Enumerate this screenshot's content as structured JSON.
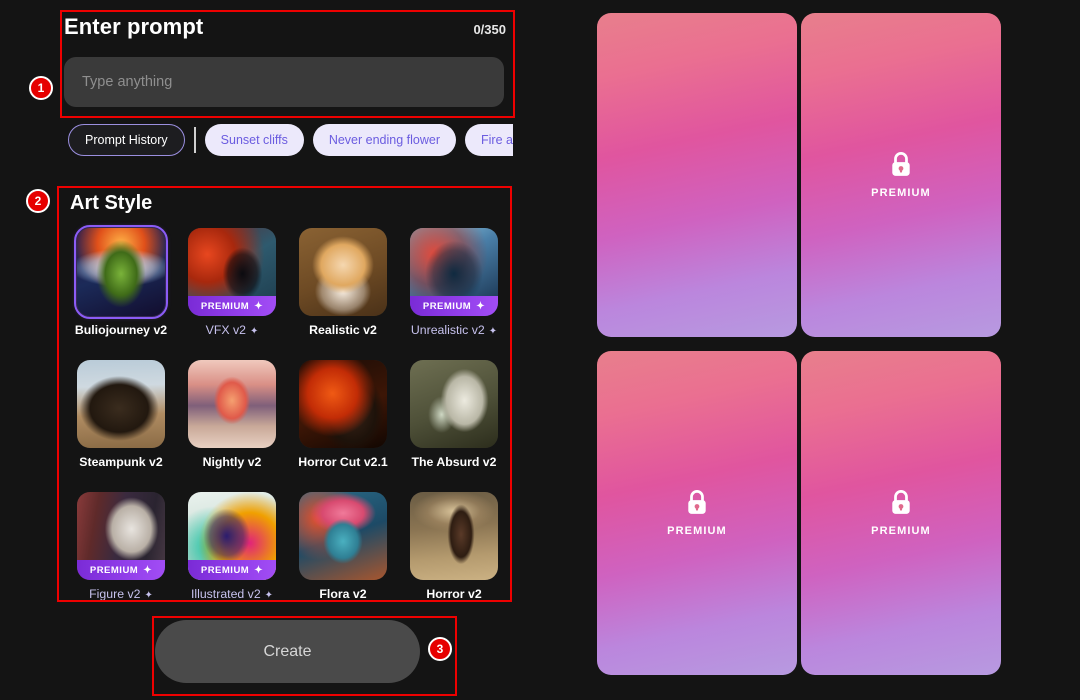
{
  "app": {
    "background": "#141414",
    "accent_purple": "#8b5cf6",
    "annotation_color": "#ee0000"
  },
  "prompt": {
    "title": "Enter prompt",
    "counter": "0/350",
    "placeholder": "Type anything",
    "value": ""
  },
  "chips": {
    "history_label": "Prompt History",
    "suggestions": [
      {
        "label": "Sunset cliffs"
      },
      {
        "label": "Never ending flower"
      },
      {
        "label": "Fire and w"
      }
    ]
  },
  "art_style": {
    "title": "Art Style",
    "premium_badge_text": "PREMIUM",
    "sparkle_glyph": "✦",
    "tiles": [
      {
        "label": "Buliojourney v2",
        "premium": false,
        "selected": true,
        "sparkle": false,
        "art": "fairy-demon"
      },
      {
        "label": "VFX v2",
        "premium": true,
        "selected": false,
        "sparkle": true,
        "art": "raven-fire"
      },
      {
        "label": "Realistic v2",
        "premium": false,
        "selected": false,
        "sparkle": false,
        "art": "kitten"
      },
      {
        "label": "Unrealistic v2",
        "premium": true,
        "selected": false,
        "sparkle": true,
        "art": "ice-demon"
      },
      {
        "label": "Steampunk v2",
        "premium": false,
        "selected": false,
        "sparkle": false,
        "art": "locomotive"
      },
      {
        "label": "Nightly v2",
        "premium": false,
        "selected": false,
        "sparkle": false,
        "art": "peach-lake"
      },
      {
        "label": "Horror Cut v2.1",
        "premium": false,
        "selected": false,
        "sparkle": false,
        "art": "werewolf"
      },
      {
        "label": "The Absurd v2",
        "premium": false,
        "selected": false,
        "sparkle": false,
        "art": "bird-suit"
      },
      {
        "label": "Figure v2",
        "premium": true,
        "selected": false,
        "sparkle": true,
        "art": "figure-library"
      },
      {
        "label": "Illustrated v2",
        "premium": true,
        "selected": false,
        "sparkle": true,
        "art": "graffiti-castle"
      },
      {
        "label": "Flora v2",
        "premium": false,
        "selected": false,
        "sparkle": false,
        "art": "flower-woman"
      },
      {
        "label": "Horror v2",
        "premium": false,
        "selected": false,
        "sparkle": false,
        "art": "hooded-figure"
      }
    ]
  },
  "create": {
    "label": "Create"
  },
  "annotations": [
    {
      "number": "1",
      "target": "prompt-block"
    },
    {
      "number": "2",
      "target": "art-style-block"
    },
    {
      "number": "3",
      "target": "create-button"
    }
  ],
  "results": {
    "cards": [
      {
        "locked": false,
        "label": ""
      },
      {
        "locked": true,
        "label": "PREMIUM"
      },
      {
        "locked": true,
        "label": "PREMIUM"
      },
      {
        "locked": true,
        "label": "PREMIUM"
      }
    ]
  }
}
